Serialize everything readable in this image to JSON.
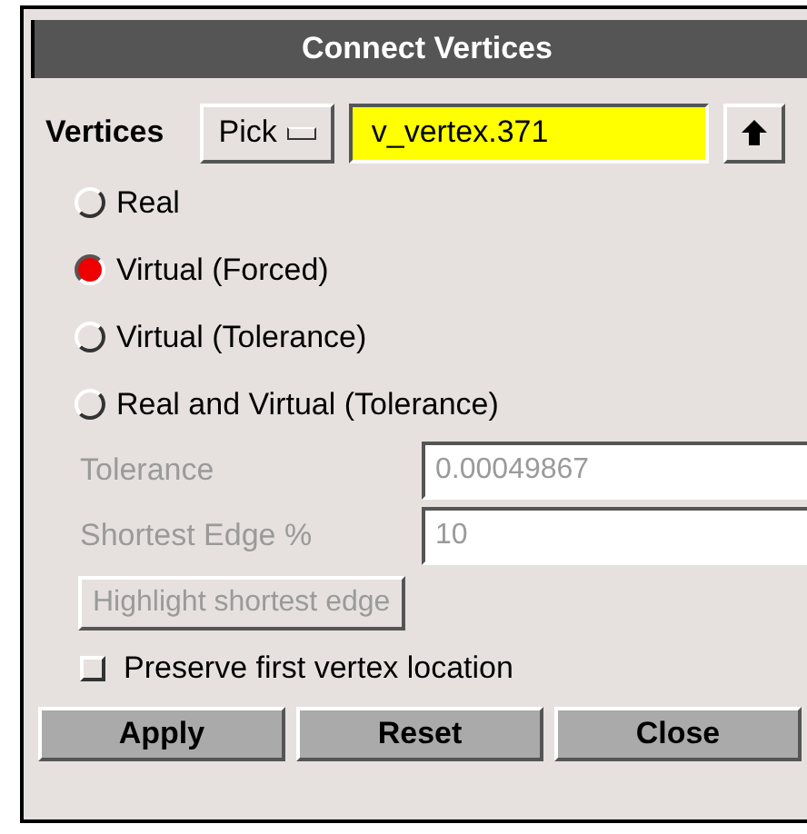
{
  "window": {
    "title": "Connect Vertices"
  },
  "vertices": {
    "label": "Vertices",
    "pick_button": "Pick",
    "value": "v_vertex.371"
  },
  "modes": [
    {
      "label": "Real",
      "selected": false
    },
    {
      "label": "Virtual (Forced)",
      "selected": true
    },
    {
      "label": "Virtual (Tolerance)",
      "selected": false
    },
    {
      "label": "Real and Virtual (Tolerance)",
      "selected": false
    }
  ],
  "fields": [
    {
      "label": "Tolerance",
      "value": "0.00049867",
      "disabled": true
    },
    {
      "label": "Shortest Edge %",
      "value": "10",
      "disabled": true
    }
  ],
  "highlight_button": {
    "label": "Highlight shortest edge",
    "disabled": true
  },
  "preserve_first": {
    "label": "Preserve first vertex location",
    "checked": false
  },
  "buttons": [
    "Apply",
    "Reset",
    "Close"
  ]
}
